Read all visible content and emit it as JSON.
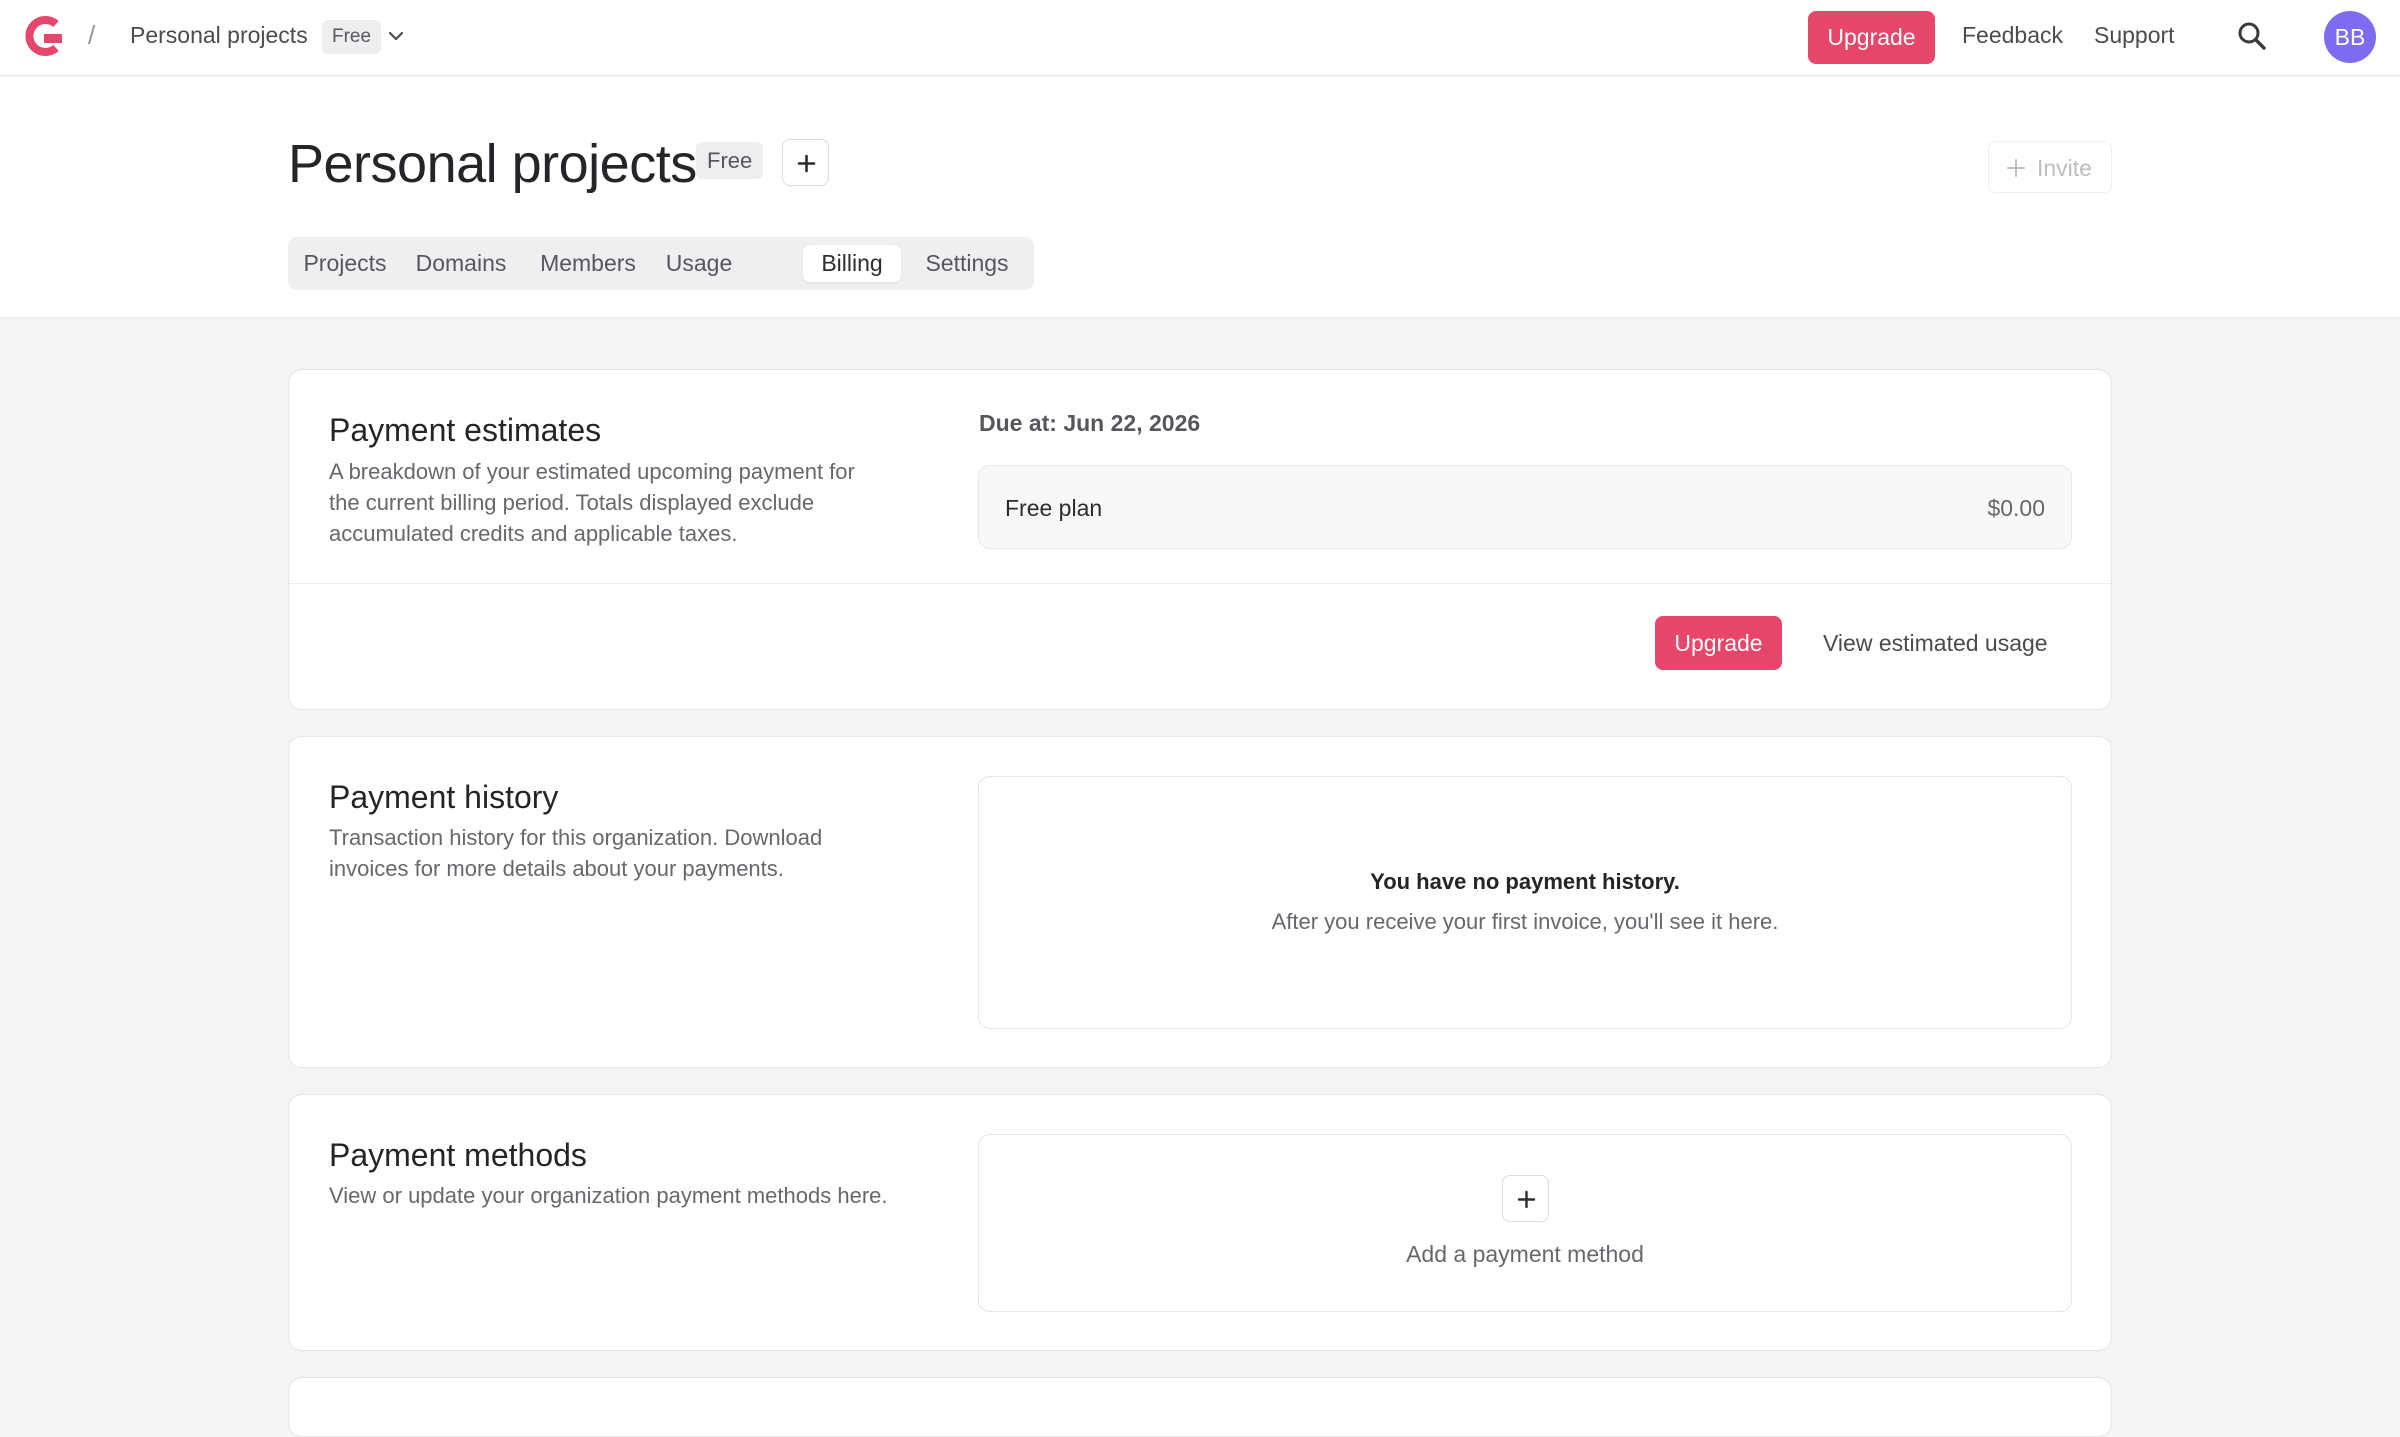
{
  "topnav": {
    "breadcrumb_separator": "/",
    "org_name": "Personal projects",
    "org_tier": "Free",
    "upgrade_label": "Upgrade",
    "feedback_label": "Feedback",
    "support_label": "Support",
    "avatar_initials": "BB",
    "icons": [
      "logo-icon",
      "chevron-down-icon",
      "search-icon"
    ]
  },
  "header": {
    "title": "Personal projects",
    "tier_badge": "Free",
    "invite_label": "Invite",
    "tabs": [
      {
        "label": "Projects",
        "active": false
      },
      {
        "label": "Domains",
        "active": false
      },
      {
        "label": "Members",
        "active": false
      },
      {
        "label": "Usage",
        "active": false
      },
      {
        "label": "Billing",
        "active": true
      },
      {
        "label": "Settings",
        "active": false
      }
    ]
  },
  "payment_estimates": {
    "title": "Payment estimates",
    "description": "A breakdown of your estimated upcoming payment for the current billing period. Totals displayed exclude accumulated credits and applicable taxes.",
    "due_at": "Due at: Jun 22, 2026",
    "plan_name": "Free plan",
    "plan_price": "$0.00",
    "upgrade_label": "Upgrade",
    "view_usage_label": "View estimated usage"
  },
  "payment_history": {
    "title": "Payment history",
    "description": "Transaction history for this organization. Download invoices for more details about your payments.",
    "empty_title": "You have no payment history.",
    "empty_subtitle": "After you receive your first invoice, you'll see it here."
  },
  "payment_methods": {
    "title": "Payment methods",
    "description": "View or update your organization payment methods here.",
    "add_label": "Add a payment method"
  },
  "colors": {
    "accent": "#e5466a",
    "avatar": "#7c6cf0"
  }
}
